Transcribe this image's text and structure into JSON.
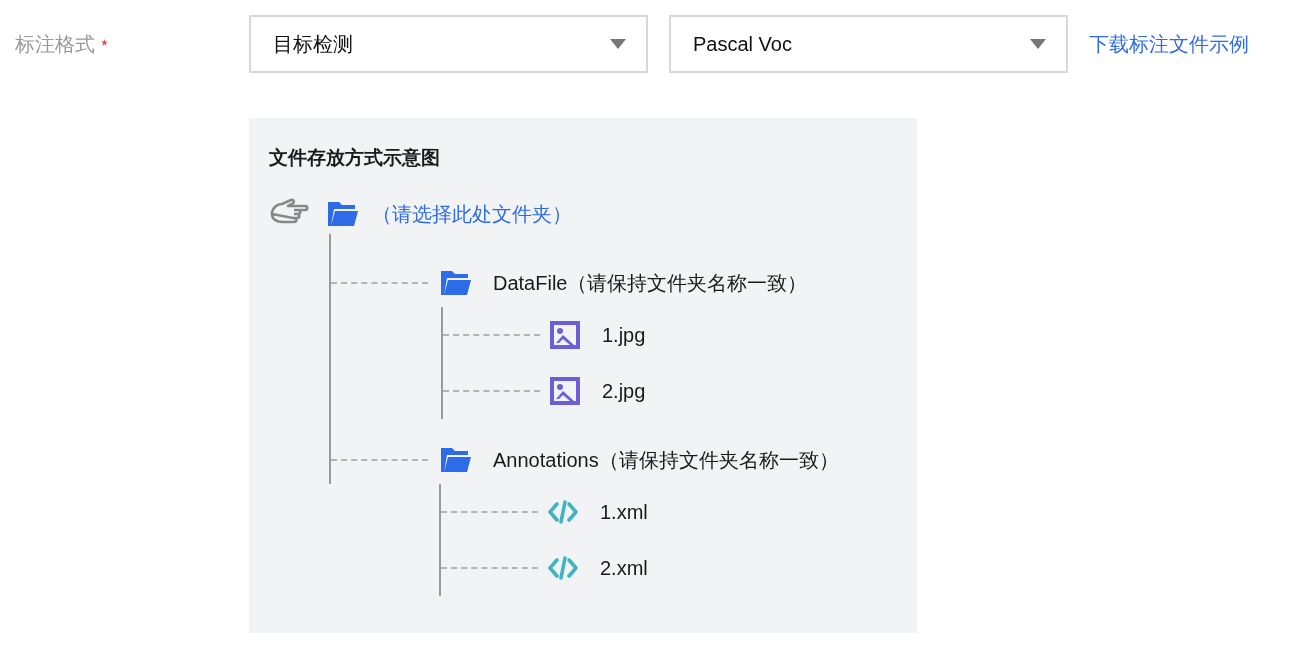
{
  "field": {
    "label": "标注格式",
    "required": true
  },
  "selects": [
    {
      "value": "目标检测"
    },
    {
      "value": "Pascal Voc"
    }
  ],
  "download_link": "下载标注文件示例",
  "diagram": {
    "title": "文件存放方式示意图",
    "root": {
      "kind": "folder",
      "name": "（请选择此处文件夹）",
      "children": [
        {
          "kind": "folder",
          "name": "DataFile（请保持文件夹名称一致）",
          "children": [
            {
              "kind": "image",
              "name": "1.jpg"
            },
            {
              "kind": "image",
              "name": "2.jpg"
            }
          ]
        },
        {
          "kind": "folder",
          "name": "Annotations（请保持文件夹名称一致）",
          "children": [
            {
              "kind": "code",
              "name": "1.xml"
            },
            {
              "kind": "code",
              "name": "2.xml"
            }
          ]
        }
      ]
    }
  }
}
